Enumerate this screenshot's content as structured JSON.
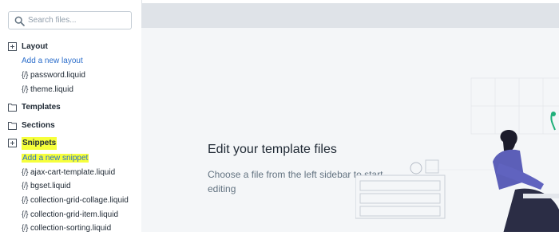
{
  "search": {
    "placeholder": "Search files...",
    "icon": "search-icon"
  },
  "tree": {
    "layout": {
      "label": "Layout",
      "icon": "expand-icon",
      "add_link": "Add a new layout",
      "files": [
        "password.liquid",
        "theme.liquid"
      ]
    },
    "templates": {
      "label": "Templates",
      "icon": "folder-icon"
    },
    "sections": {
      "label": "Sections",
      "icon": "folder-icon"
    },
    "snippets": {
      "label": "Snippets",
      "icon": "expand-icon",
      "add_link": "Add a new snippet",
      "files": [
        "ajax-cart-template.liquid",
        "bgset.liquid",
        "collection-grid-collage.liquid",
        "collection-grid-item.liquid",
        "collection-sorting.liquid"
      ]
    },
    "file_icon": "{/}"
  },
  "main": {
    "title": "Edit your template files",
    "description": "Choose a file from the left sidebar to start editing"
  },
  "colors": {
    "link": "#2c6ecb",
    "highlight": "#f6ff3b",
    "illustration_purple": "#5c5fb8"
  }
}
